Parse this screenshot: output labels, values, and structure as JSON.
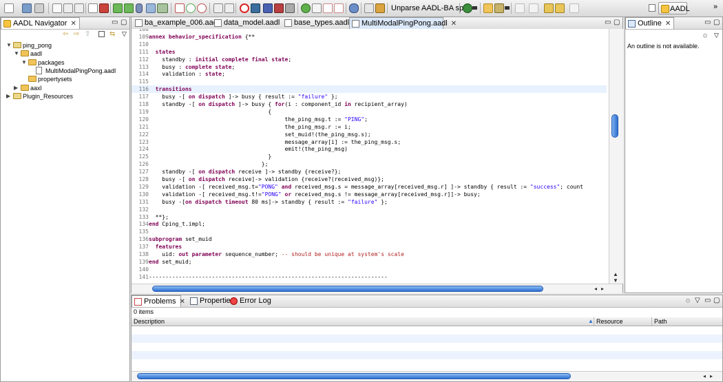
{
  "toolbar": {
    "unparse_label": "Unparse AADL-BA spec",
    "perspective_label": "AADL",
    "more": "»"
  },
  "navigator": {
    "title": "AADL Navigator",
    "tree": [
      {
        "label": "ping_pong",
        "depth": 0,
        "expanded": true,
        "kind": "project"
      },
      {
        "label": "aadl",
        "depth": 1,
        "expanded": true,
        "kind": "folder"
      },
      {
        "label": "packages",
        "depth": 2,
        "expanded": true,
        "kind": "folder"
      },
      {
        "label": "MultiModalPingPong.aadl",
        "depth": 3,
        "kind": "file"
      },
      {
        "label": "propertysets",
        "depth": 2,
        "kind": "folder"
      },
      {
        "label": "aaxl",
        "depth": 1,
        "expanded": false,
        "kind": "folder"
      },
      {
        "label": "Plugin_Resources",
        "depth": 0,
        "expanded": false,
        "kind": "project"
      }
    ]
  },
  "editor": {
    "tabs": [
      {
        "label": "ba_example_006.aadl",
        "active": false
      },
      {
        "label": "data_model.aadl",
        "active": false
      },
      {
        "label": "base_types.aadl",
        "active": false
      },
      {
        "label": "MultiModalPingPong.aadl",
        "active": true
      }
    ],
    "lines": [
      {
        "n": "108",
        "t": ""
      },
      {
        "n": "109",
        "t": "annex behavior_specification {**"
      },
      {
        "n": "110",
        "t": ""
      },
      {
        "n": "111",
        "t": "  states"
      },
      {
        "n": "112",
        "t": "    standby : initial complete final state;"
      },
      {
        "n": "113",
        "t": "    busy : complete state;"
      },
      {
        "n": "114",
        "t": "    validation : state;"
      },
      {
        "n": "115",
        "t": ""
      },
      {
        "n": "116",
        "t": "  transitions"
      },
      {
        "n": "117",
        "t": "    busy -[ on dispatch ]-> busy { result := \"failure\" };"
      },
      {
        "n": "118",
        "t": "    standby -[ on dispatch ]-> busy { for(i : component_id in recipient_array)"
      },
      {
        "n": "119",
        "t": "                                    {"
      },
      {
        "n": "120",
        "t": "                                         the_ping_msg.t := \"PING\";"
      },
      {
        "n": "121",
        "t": "                                         the_ping_msg.r := i;"
      },
      {
        "n": "122",
        "t": "                                         set_muid!(the_ping_msg.s);"
      },
      {
        "n": "123",
        "t": "                                         message_array[i] := the_ping_msg.s;"
      },
      {
        "n": "124",
        "t": "                                         emit!(the_ping_msg)"
      },
      {
        "n": "125",
        "t": "                                    }"
      },
      {
        "n": "126",
        "t": "                                  };"
      },
      {
        "n": "127",
        "t": "    standby -[ on dispatch receive ]-> standby {receive?};"
      },
      {
        "n": "128",
        "t": "    busy -[ on dispatch receive]-> validation {receive?(received_msg)};"
      },
      {
        "n": "129",
        "t": "    validation -[ received_msg.t=\"PONG\" and received_msg.s = message_array[received_msg.r] ]-> standby { result := \"success\"; count"
      },
      {
        "n": "130",
        "t": "    validation -[ received_msg.t!=\"PONG\" or received_msg.s != message_array[received_msg.r]]-> busy;"
      },
      {
        "n": "131",
        "t": "    busy -[on dispatch timeout 80 ms]-> standby { result := \"failure\" };"
      },
      {
        "n": "132",
        "t": ""
      },
      {
        "n": "133",
        "t": "  **};"
      },
      {
        "n": "134",
        "t": "end Cping_t.impl;"
      },
      {
        "n": "135",
        "t": ""
      },
      {
        "n": "136",
        "t": "subprogram set_muid"
      },
      {
        "n": "137",
        "t": "  features"
      },
      {
        "n": "138",
        "t": "    uid: out parameter sequence_number; -- should be unique at system's scale"
      },
      {
        "n": "139",
        "t": "end set_muid;"
      },
      {
        "n": "140",
        "t": ""
      },
      {
        "n": "141",
        "t": "------------------------------------------------------------------------"
      }
    ]
  },
  "outline": {
    "title": "Outline",
    "message": "An outline is not available."
  },
  "problems": {
    "tabs": [
      {
        "label": "Problems",
        "active": true
      },
      {
        "label": "Properties",
        "active": false
      },
      {
        "label": "Error Log",
        "active": false
      }
    ],
    "count": "0 items",
    "columns": [
      "Description",
      "Resource",
      "Path"
    ]
  }
}
